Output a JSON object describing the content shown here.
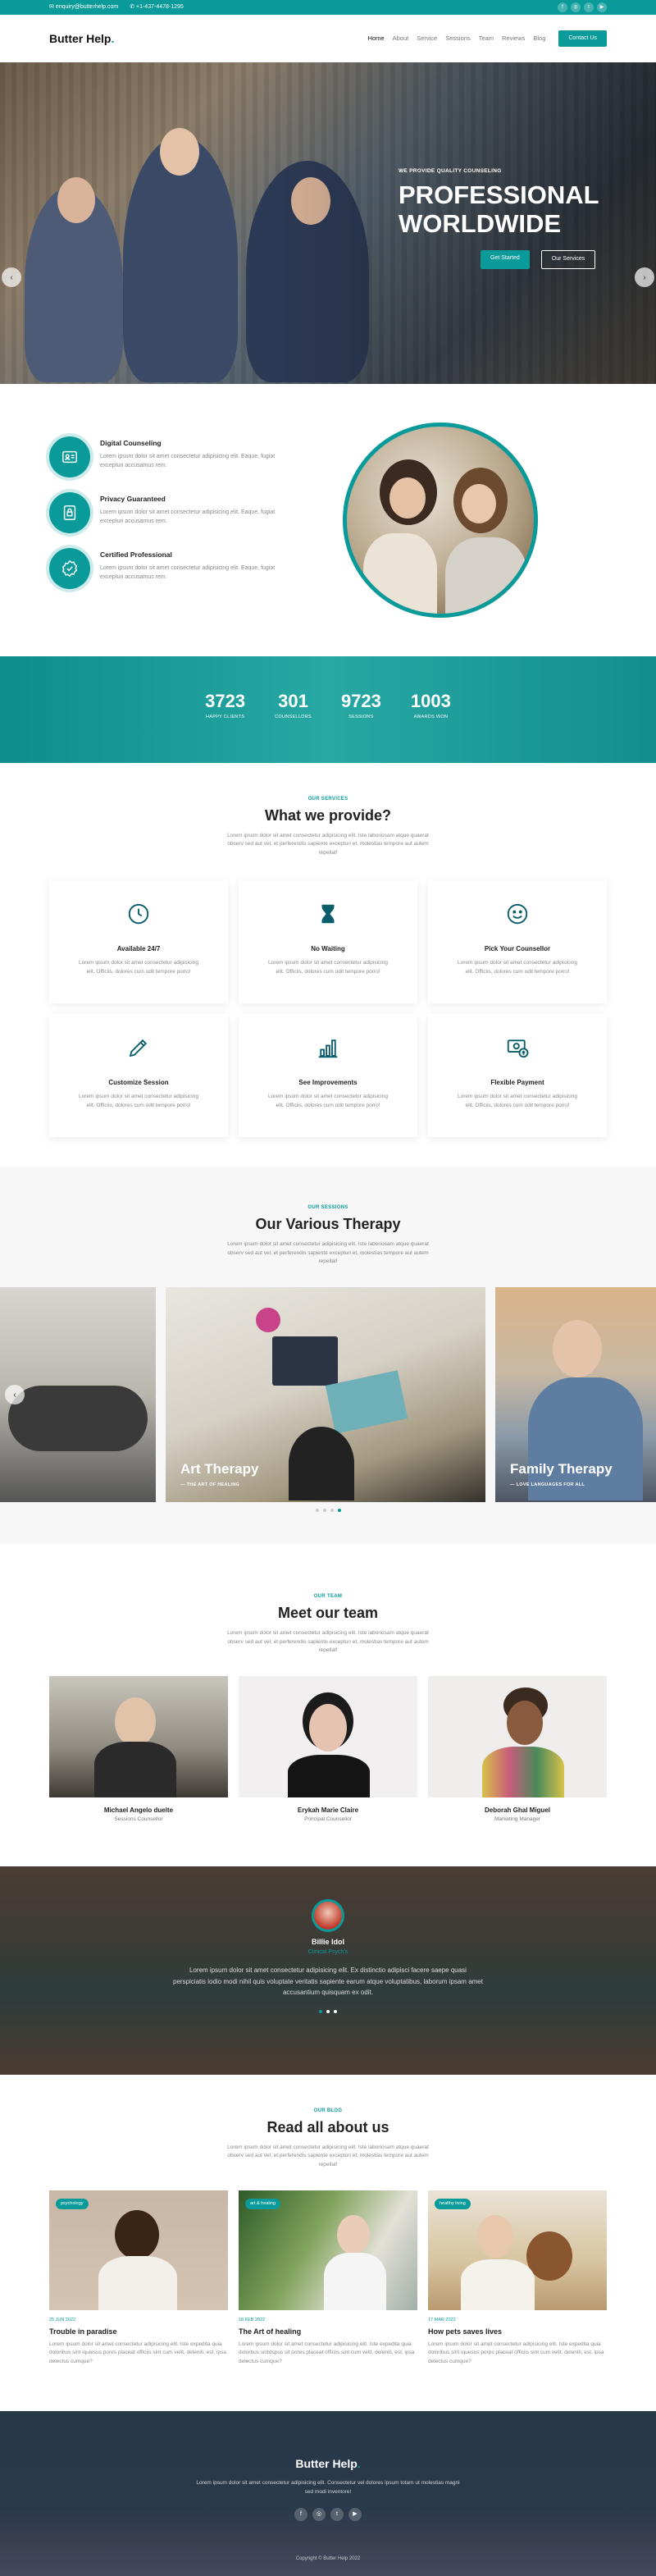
{
  "topbar": {
    "email": "enquiry@butterhelp.com",
    "phone": "+1-437-4478-1295",
    "social": [
      "f",
      "◎",
      "t",
      "▶"
    ]
  },
  "nav": {
    "logo": "Butter Help",
    "items": [
      "Home",
      "About",
      "Service",
      "Sessions",
      "Team",
      "Reviews",
      "Blog"
    ],
    "cta": "Contact Us"
  },
  "hero": {
    "kicker": "WE PROVIDE QUALITY COUNSELING",
    "title_line1": "PROFESSIONAL",
    "title_line2": "WORLDWIDE",
    "btn1": "Get Started",
    "btn2": "Our Services",
    "prev": "‹",
    "next": "›"
  },
  "features": [
    {
      "title": "Digital Counseling",
      "text": "Lorem ipsum dolor sit amet consectetur adipisicing elit. Eaque, fugiat excepturi accusamus rem."
    },
    {
      "title": "Privacy Guaranteed",
      "text": "Lorem ipsum dolor sit amet consectetur adipisicing elit. Eaque, fugiat excepturi accusamus rem."
    },
    {
      "title": "Certified Professional",
      "text": "Lorem ipsum dolor sit amet consectetur adipisicing elit. Eaque, fugiat excepturi accusamus rem."
    }
  ],
  "stats": [
    {
      "n": "3723",
      "l": "HAPPY CLIENTS"
    },
    {
      "n": "301",
      "l": "COUNSELLORS"
    },
    {
      "n": "9723",
      "l": "SESSIONS"
    },
    {
      "n": "1003",
      "l": "AWARDS WON"
    }
  ],
  "services": {
    "kicker": "OUR SERVICES",
    "title": "What we provide?",
    "lead": "Lorem ipsum dolor sit amet consectetur adipisicing elit. Iste laboriosam atque quaerat observ sed aut vel, et perferendis sapiente excepturi et, molestias tempore aut autem repellat!",
    "cards": [
      {
        "title": "Available 24/7",
        "text": "Lorem ipsum dolor sit amet consectetur adipisicing elit. Officiis, dolores cum odit tempore porro!"
      },
      {
        "title": "No Waiting",
        "text": "Lorem ipsum dolor sit amet consectetur adipisicing elit. Officiis, dolores cum odit tempore porro!"
      },
      {
        "title": "Pick Your Counsellor",
        "text": "Lorem ipsum dolor sit amet consectetur adipisicing elit. Officiis, dolores cum odit tempore porro!"
      },
      {
        "title": "Customize Session",
        "text": "Lorem ipsum dolor sit amet consectetur adipisicing elit. Officiis, dolores cum odit tempore porro!"
      },
      {
        "title": "See Improvements",
        "text": "Lorem ipsum dolor sit amet consectetur adipisicing elit. Officiis, dolores cum odit tempore porro!"
      },
      {
        "title": "Flexible Payment",
        "text": "Lorem ipsum dolor sit amet consectetur adipisicing elit. Officiis, dolores cum odit tempore porro!"
      }
    ]
  },
  "therapy": {
    "kicker": "OUR SESSIONS",
    "title": "Our Various Therapy",
    "lead": "Lorem ipsum dolor sit amet consectetur adipisicing elit. Iste laboriosam atque quaerat observ sed aut vel, et perferendis sapiente excepturi et, molestias tempore aut autem repellat!",
    "slides": [
      {
        "title": "Art Therapy",
        "sub": "THE ART OF HEALING"
      },
      {
        "title": "Family Therapy",
        "sub": "LOVE LANGUAGES FOR ALL"
      }
    ],
    "prev": "‹"
  },
  "team": {
    "kicker": "OUR TEAM",
    "title": "Meet our team",
    "lead": "Lorem ipsum dolor sit amet consectetur adipisicing elit. Iste laboriosam atque quaerat observ sed aut vel, et perferendis sapiente excepturi et, molestias tempore aut autem repellat!",
    "members": [
      {
        "name": "Michael Angelo duelte",
        "role": "Sessions Counsellor"
      },
      {
        "name": "Erykah Marie Claire",
        "role": "Principal Counsellor"
      },
      {
        "name": "Deborah Ghal Miguel",
        "role": "Marketing Manager"
      }
    ]
  },
  "testimonial": {
    "name": "Billie Idol",
    "role": "Clinical Psych's",
    "text": "Lorem ipsum dolor sit amet consectetur adipisicing elit. Ex distinctio adipisci facere saepe quasi perspiciatis iodio modi nihil quis voluptate veritatis sapiente earum atque voluptatibus, laborum ipsam amet accusantium quisquam ex odit."
  },
  "blog": {
    "kicker": "OUR BLOG",
    "title": "Read all about us",
    "lead": "Lorem ipsum dolor sit amet consectetur adipisicing elit. Iste laboriosam atque quaerat observ sed aut vel, et perferendis sapiente excepturi et, molestias tempore aut autem repellat!",
    "posts": [
      {
        "tag": "psychology",
        "date": "25 JUN 2022",
        "title": "Trouble in paradise",
        "text": "Lorem ipsum dolor sit amet consectetur adipisicing elit. Iste expedita quia doloribus sint iquiesus pores placeat officiis sint cum velit, deleniti, est, ipsa delectus cumque?"
      },
      {
        "tag": "art & healing",
        "date": "18 FEB 2022",
        "title": "The Art of healing",
        "text": "Lorem ipsum dolor sit amet consectetur adipisicing elit. Iste expedita quia dolorbus sintdspus sit pores placeat officiis sint cum velit, deleniti, est, ipsa delectus cumque?"
      },
      {
        "tag": "healthy living",
        "date": "17 MAR 2022",
        "title": "How pets saves lives",
        "text": "Lorem ipsum dolor sit amet consectetur adipisicing elit. Iste expedita quia doloribus sint iquesus porps placeat officiis sint cum velit, deleniti, est, ipsa delectus cumque?"
      }
    ]
  },
  "footer": {
    "logo": "Butter Help",
    "text": "Lorem ipsum dolor sit amet consectetur adipisicing elit. Consectetur vel dolores ipsum totam ut molestias magni sed modi inventore!",
    "social": [
      "f",
      "◎",
      "t",
      "▶"
    ],
    "copyright": "Copyright © Butter Help 2022"
  },
  "colors": {
    "accent": "#0a9a9a"
  }
}
